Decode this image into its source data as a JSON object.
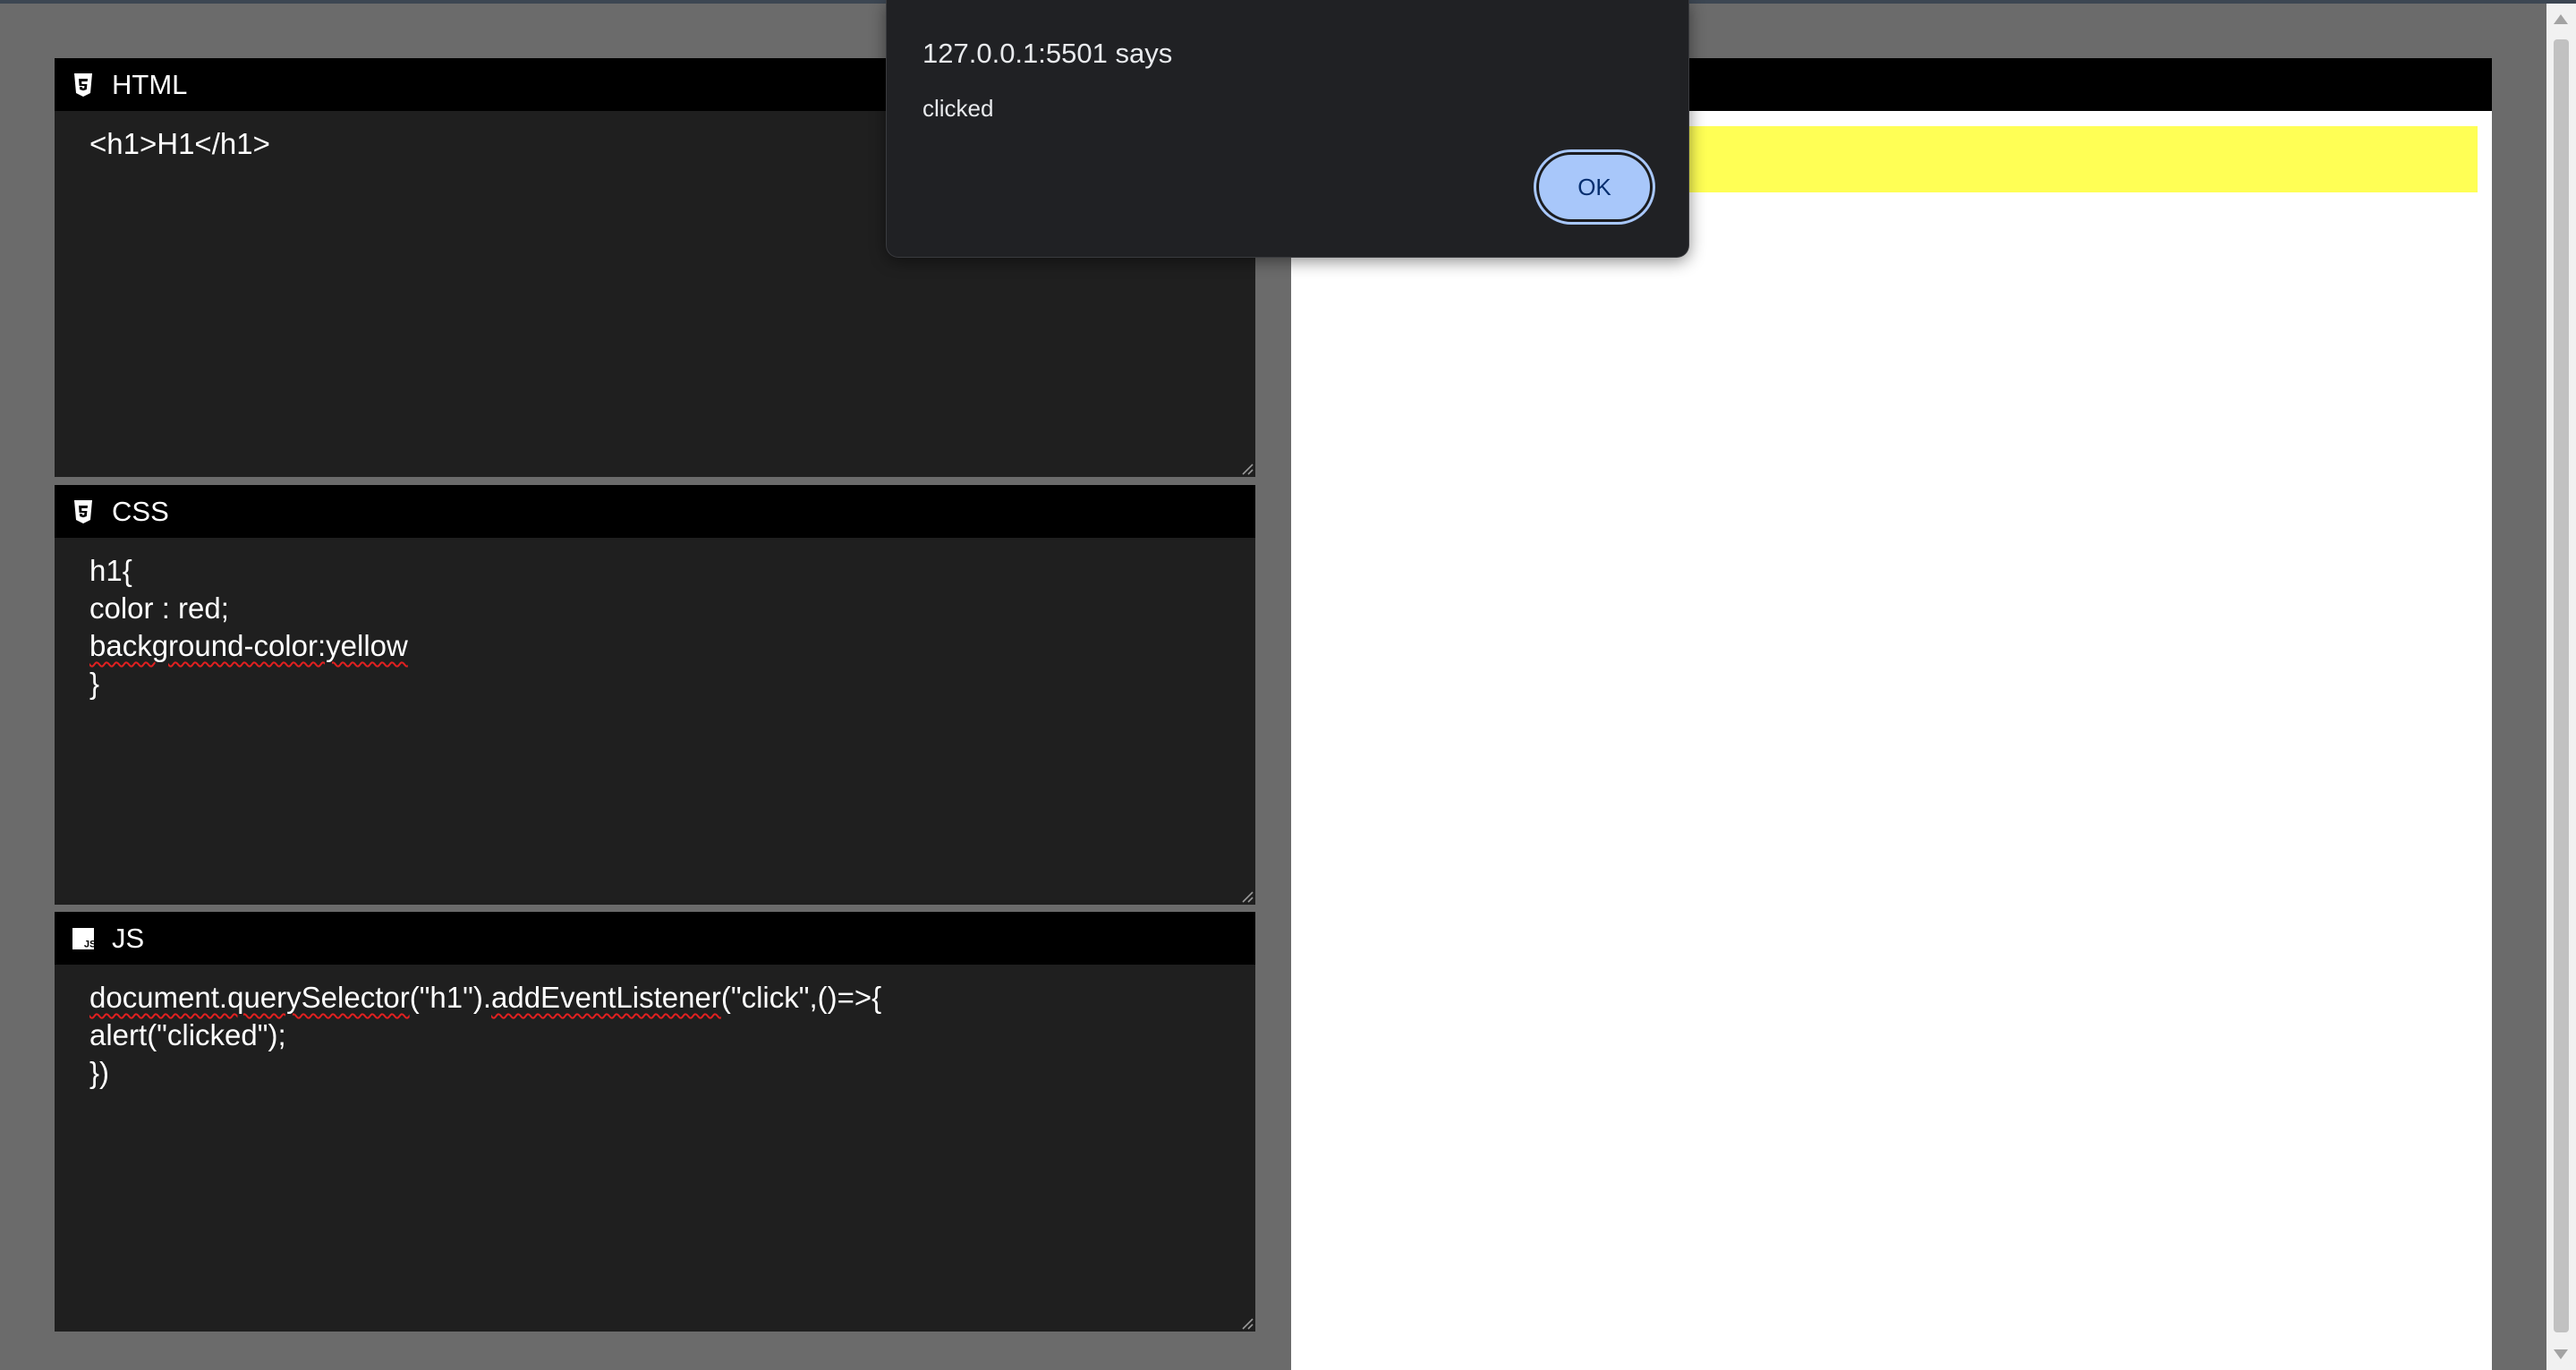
{
  "editors": {
    "html": {
      "title": "HTML",
      "icon": "html5-icon",
      "lines": [
        "<h1>H1</h1>"
      ]
    },
    "css": {
      "title": "CSS",
      "icon": "css3-icon",
      "lines": [
        "h1{",
        "color : red;",
        "background-color:yellow",
        "}"
      ]
    },
    "js": {
      "title": "JS",
      "icon": "js-icon",
      "lines": [
        "document.querySelector(\"h1\").addEventListener(\"click\",()=>{",
        "alert(\"clicked\");",
        "})"
      ]
    }
  },
  "preview": {
    "heading_background": "#ffff55"
  },
  "dialog": {
    "title": "127.0.0.1:5501 says",
    "message": "clicked",
    "ok_label": "OK"
  },
  "colors": {
    "background": "#6b6b6b",
    "editor_bg": "#1f1f1f",
    "header_bg": "#000000",
    "dialog_bg": "#202124",
    "ok_button": "#a8c7fa"
  }
}
